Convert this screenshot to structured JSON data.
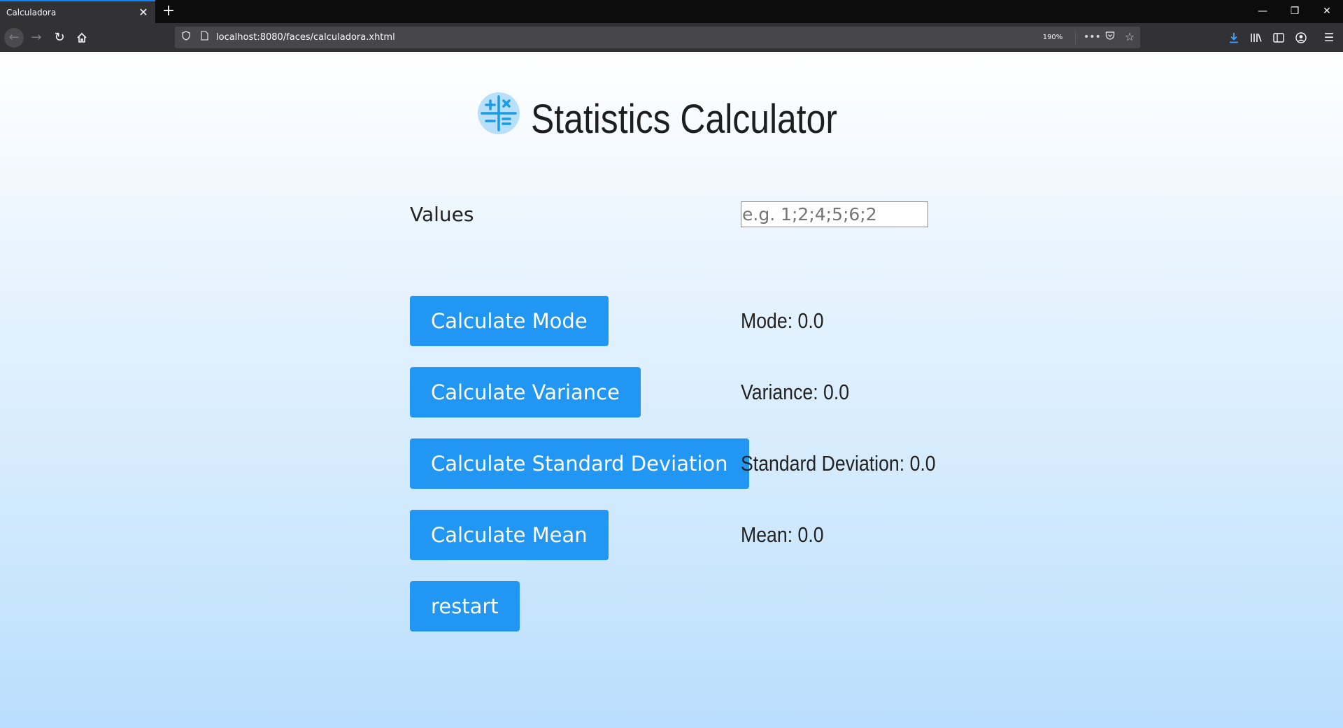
{
  "browser": {
    "tab_title": "Calculadora",
    "url": "localhost:8080/faces/calculadora.xhtml",
    "zoom": "190%"
  },
  "icons": {
    "tab_close": "close-icon",
    "new_tab": "plus-icon",
    "back": "arrow-left-icon",
    "forward": "arrow-right-icon",
    "reload": "reload-icon",
    "home": "home-icon",
    "tracking": "shield-icon",
    "page_info": "page-icon",
    "more": "ellipsis-icon",
    "pocket": "pocket-icon",
    "bookmark": "star-icon",
    "downloads": "download-icon",
    "library": "library-icon",
    "sidebar": "sidebar-icon",
    "account": "account-icon",
    "menu": "hamburger-icon",
    "logo": "calculator-icon"
  },
  "colors": {
    "accent": "#2196f3",
    "tab_highlight": "#0a84ff",
    "logo_bg": "#b8e0fb",
    "logo_glyph": "#1a9be6"
  },
  "page": {
    "title": "Statistics Calculator",
    "values_label": "Values",
    "values_value": "",
    "values_placeholder": "e.g. 1;2;4;5;6;2",
    "buttons": {
      "mode": "Calculate Mode",
      "variance": "Calculate Variance",
      "std_dev": "Calculate Standard Deviation",
      "mean": "Calculate Mean",
      "restart": "restart"
    },
    "results": {
      "mode": "Mode: 0.0",
      "variance": "Variance: 0.0",
      "std_dev": "Standard Deviation: 0.0",
      "mean": "Mean: 0.0"
    }
  }
}
